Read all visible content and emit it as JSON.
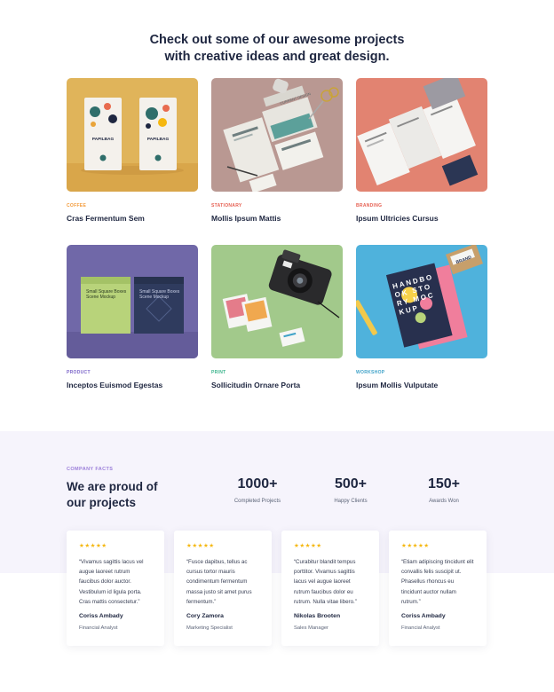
{
  "projects_section": {
    "heading_line1": "Check out some of our awesome projects",
    "heading_line2": "with creative ideas and great design."
  },
  "projects": [
    {
      "category": "Coffee",
      "title": "Cras Fermentum Sem",
      "category_color": "#f39b3a",
      "bg": "#e0b45a"
    },
    {
      "category": "Stationary",
      "title": "Mollis Ipsum Mattis",
      "category_color": "#e65f51",
      "bg": "#b99892"
    },
    {
      "category": "Branding",
      "title": "Ipsum Ultricies Cursus",
      "category_color": "#e65f51",
      "bg": "#e28371"
    },
    {
      "category": "Product",
      "title": "Inceptos Euismod Egestas",
      "category_color": "#7c66c9",
      "bg": "#7068a8"
    },
    {
      "category": "Print",
      "title": "Sollicitudin Ornare Porta",
      "category_color": "#3cb48c",
      "bg": "#a2c98b"
    },
    {
      "category": "Workshop",
      "title": "Ipsum Mollis Vulputate",
      "category_color": "#3fa2c8",
      "bg": "#4fb2dc"
    }
  ],
  "facts": {
    "label": "COMPANY FACTS",
    "title_line1": "We are proud of",
    "title_line2": "our projects",
    "stats": [
      {
        "value": "1000+",
        "label": "Completed Projects"
      },
      {
        "value": "500+",
        "label": "Happy Clients"
      },
      {
        "value": "150+",
        "label": "Awards Won"
      }
    ]
  },
  "testimonials": [
    {
      "stars": "★★★★★",
      "quote": "“Vivamus sagittis lacus vel augue laoreet rutrum faucibus dolor auctor. Vestibulum id ligula porta. Cras mattis consectetur.”",
      "name": "Coriss Ambady",
      "role": "Financial Analyst"
    },
    {
      "stars": "★★★★★",
      "quote": "“Fusce dapibus, tellus ac cursus tortor mauris condimentum fermentum massa justo sit amet purus fermentum.”",
      "name": "Cory Zamora",
      "role": "Marketing Specialist"
    },
    {
      "stars": "★★★★★",
      "quote": "“Curabitur blandit tempus porttitor. Vivamus sagittis lacus vel augue laoreet rutrum faucibus dolor eu rutrum. Nulla vitae libero.”",
      "name": "Nikolas Brooten",
      "role": "Sales Manager"
    },
    {
      "stars": "★★★★★",
      "quote": "“Etiam adipiscing tincidunt elit convallis felis suscipit ut. Phasellus rhoncus eu tincidunt auctor nullam rutrum.”",
      "name": "Coriss Ambady",
      "role": "Financial Analyst"
    }
  ],
  "mockup_text": {
    "coffee_brand": "PAPILBAG",
    "stationery_text": "CURRENT DESIGN",
    "box_label": "Small Square Boxes Scene Mockup",
    "book_letters": "HANDBOOK STORY MOCKUP",
    "tag_text": "BRAND"
  }
}
